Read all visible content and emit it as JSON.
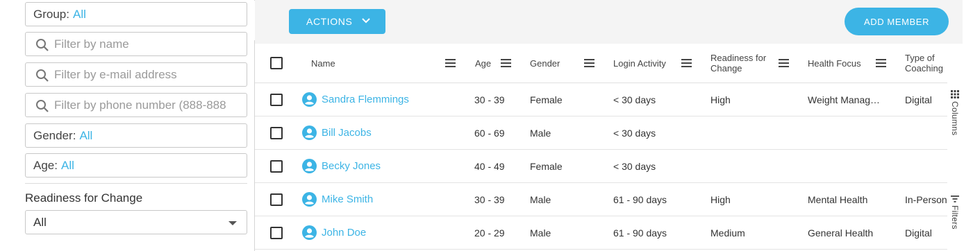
{
  "filters": {
    "group": {
      "label": "Group:",
      "value": "All"
    },
    "name_placeholder": "Filter by name",
    "email_placeholder": "Filter by e-mail address",
    "phone_placeholder": "Filter by phone number (888-888",
    "gender": {
      "label": "Gender:",
      "value": "All"
    },
    "age": {
      "label": "Age:",
      "value": "All"
    },
    "readiness": {
      "label": "Readiness for Change",
      "value": "All"
    }
  },
  "toolbar": {
    "actions_label": "ACTIONS",
    "add_member_label": "ADD MEMBER"
  },
  "columns": {
    "name": "Name",
    "age": "Age",
    "gender": "Gender",
    "login": "Login Activity",
    "readiness": "Readiness for Change",
    "focus": "Health Focus",
    "coaching": "Type of Coaching"
  },
  "rows": [
    {
      "name": "Sandra Flemmings",
      "age": "30 - 39",
      "gender": "Female",
      "login": "< 30 days",
      "readiness": "High",
      "focus": "Weight Manag…",
      "coaching": "Digital"
    },
    {
      "name": "Bill Jacobs",
      "age": "60 - 69",
      "gender": "Male",
      "login": "< 30 days",
      "readiness": "",
      "focus": "",
      "coaching": ""
    },
    {
      "name": "Becky Jones",
      "age": "40 - 49",
      "gender": "Female",
      "login": "< 30 days",
      "readiness": "",
      "focus": "",
      "coaching": ""
    },
    {
      "name": "Mike Smith",
      "age": "30 - 39",
      "gender": "Male",
      "login": "61 - 90 days",
      "readiness": "High",
      "focus": "Mental Health",
      "coaching": "In-Person"
    },
    {
      "name": "John Doe",
      "age": "20 - 29",
      "gender": "Male",
      "login": "61 - 90 days",
      "readiness": "Medium",
      "focus": "General Health",
      "coaching": "Digital"
    }
  ],
  "side_panel": {
    "columns_label": "Columns",
    "filters_label": "Filters"
  },
  "colors": {
    "accent": "#3cb4e5"
  },
  "icons": {
    "search": "search-icon",
    "collapse": "chevron-left-icon",
    "dropdown": "chevron-down-icon",
    "column_menu": "menu-icon",
    "member": "user-avatar-icon",
    "columns": "grid-icon",
    "filters": "filter-icon"
  }
}
